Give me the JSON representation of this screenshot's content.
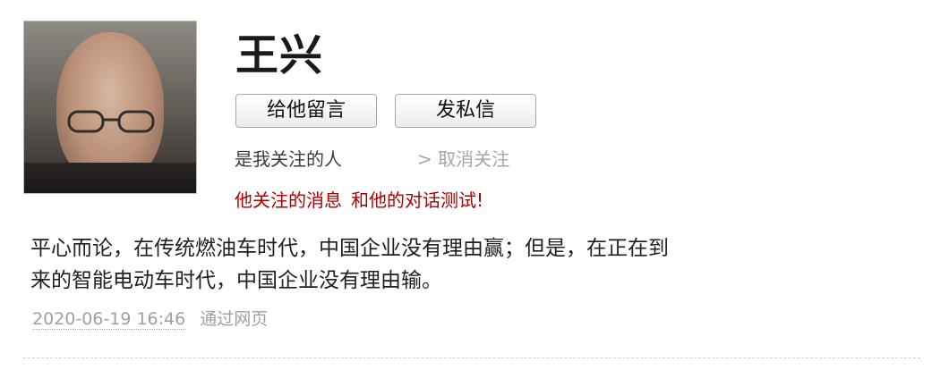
{
  "profile": {
    "name": "王兴",
    "leave_message_label": "给他留言",
    "private_message_label": "发私信",
    "follow_status": "是我关注的人",
    "unfollow_label": "> 取消关注",
    "his_follows_label": "他关注的消息",
    "conversation_label": "和他的对话",
    "test_label": "测试!"
  },
  "post": {
    "line1": "平心而论，在传统燃油车时代，中国企业没有理由赢；但是，在正在到",
    "line2": "来的智能电动车时代，中国企业没有理由输。",
    "timestamp": "2020-06-19 16:46",
    "source": "通过网页"
  },
  "colors": {
    "accent_red": "#b00000",
    "muted_text": "#a0a0a0"
  },
  "icons": {
    "avatar": "user-avatar"
  }
}
